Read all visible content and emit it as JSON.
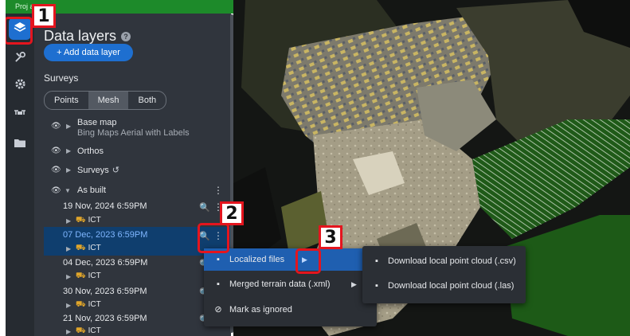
{
  "project_bar": {
    "text": "Proj                   ate"
  },
  "rail": {
    "icons": [
      "layers-icon",
      "tools-icon",
      "settings-icon",
      "drone-icon",
      "folder-icon"
    ]
  },
  "panel": {
    "title": "Data layers",
    "help": "?",
    "add_button": "+ Add data layer",
    "surveys_label": "Surveys",
    "view_modes": [
      "Points",
      "Mesh",
      "Both"
    ],
    "active_view_mode": "Mesh",
    "layers": {
      "base_map": {
        "name": "Base map",
        "sub": "Bing Maps Aerial with Labels"
      },
      "orthos": "Orthos",
      "surveys": "Surveys",
      "as_built": "As built"
    },
    "dates": [
      "19 Nov, 2024 6:59PM",
      "07 Dec, 2023 6:59PM",
      "04 Dec, 2023 6:59PM",
      "30 Nov, 2023 6:59PM",
      "21 Nov, 2023 6:59PM"
    ],
    "ict_label": "ICT"
  },
  "context_menu": {
    "items": [
      "Localized files",
      "Merged terrain data (.xml)",
      "Mark as ignored"
    ]
  },
  "submenu": {
    "items": [
      "Download local point cloud (.csv)",
      "Download local point cloud (.las)"
    ]
  },
  "annotations": [
    "1",
    "2",
    "3"
  ],
  "colors": {
    "accent": "#1e6fd0",
    "highlight": "#e4151e",
    "project_bar": "#1d8a2a"
  }
}
